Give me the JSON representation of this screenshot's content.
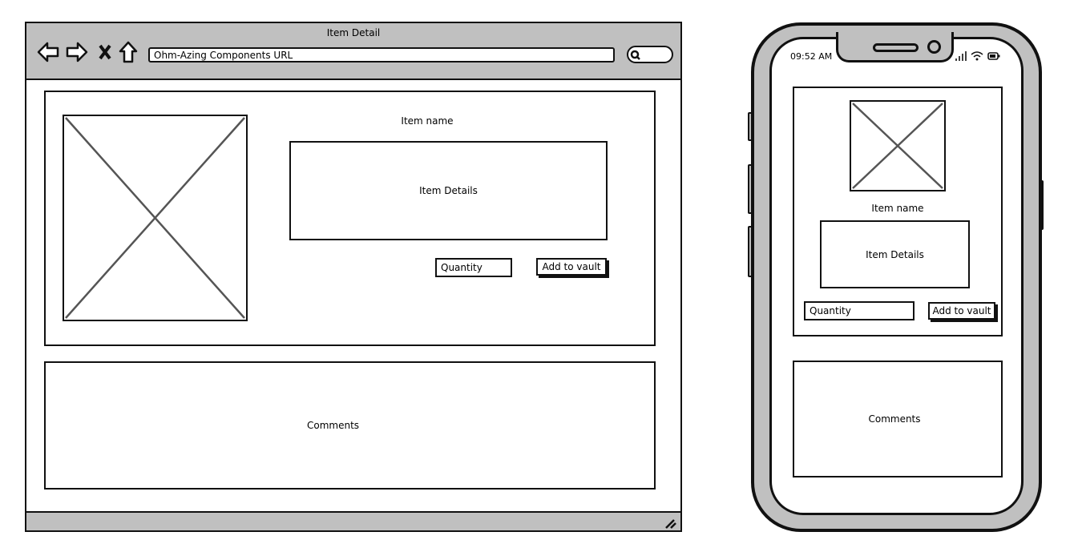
{
  "browser": {
    "title": "Item Detail",
    "url": "Ohm-Azing Components URL",
    "icons": [
      "back-arrow-icon",
      "forward-arrow-icon",
      "close-icon",
      "home-icon",
      "search-icon",
      "resize-grip-icon"
    ],
    "item_name": "Item name",
    "item_details": "Item Details",
    "quantity_placeholder": "Quantity",
    "add_button": "Add to vault",
    "comments": "Comments"
  },
  "phone": {
    "time": "09:52 AM",
    "icons": [
      "signal-icon",
      "wifi-icon",
      "battery-icon"
    ],
    "item_name": "Item name",
    "item_details": "Item Details",
    "quantity_placeholder": "Quantity",
    "add_button": "Add to vault",
    "comments": "Comments"
  },
  "colors": {
    "chrome": "#c0c0c0",
    "stroke": "#111111",
    "placeholder_x": "#555555"
  }
}
